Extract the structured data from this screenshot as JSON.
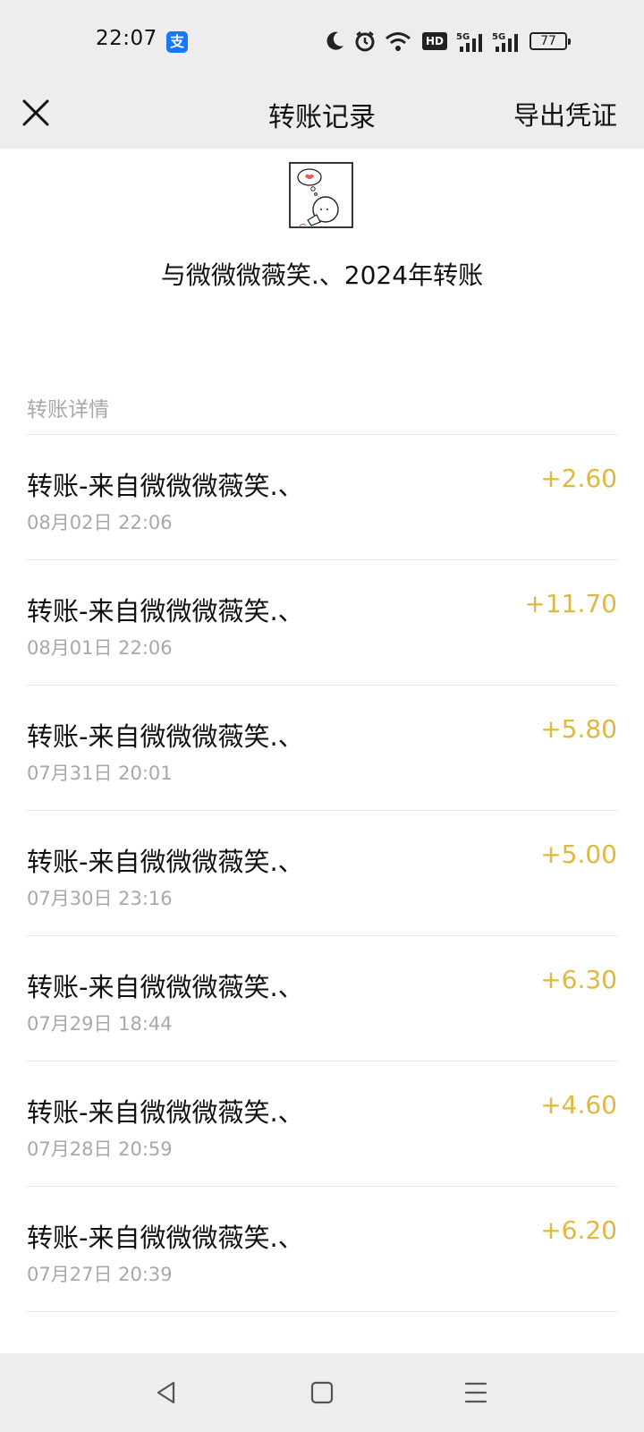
{
  "status_bar": {
    "time": "22:07",
    "app_badge": "支",
    "icons": [
      "moon-icon",
      "alarm-icon",
      "wifi-icon",
      "hd-icon",
      "signal-5g-icon",
      "signal-5g-icon",
      "battery-icon"
    ],
    "hd_label": "HD",
    "battery_level": "77"
  },
  "header": {
    "title": "转账记录",
    "export_label": "导出凭证"
  },
  "partner": {
    "title": "与微微微薇笑.、2024年转账"
  },
  "section_label": "转账详情",
  "colors": {
    "amount": "#e0b840",
    "secondary_text": "#a8a8a8",
    "bar_background": "#ededed"
  },
  "transactions": [
    {
      "title": "转账-来自微微微薇笑.、",
      "date": "08月02日 22:06",
      "amount": "+2.60"
    },
    {
      "title": "转账-来自微微微薇笑.、",
      "date": "08月01日 22:06",
      "amount": "+11.70"
    },
    {
      "title": "转账-来自微微微薇笑.、",
      "date": "07月31日 20:01",
      "amount": "+5.80"
    },
    {
      "title": "转账-来自微微微薇笑.、",
      "date": "07月30日 23:16",
      "amount": "+5.00"
    },
    {
      "title": "转账-来自微微微薇笑.、",
      "date": "07月29日 18:44",
      "amount": "+6.30"
    },
    {
      "title": "转账-来自微微微薇笑.、",
      "date": "07月28日 20:59",
      "amount": "+4.60"
    },
    {
      "title": "转账-来自微微微薇笑.、",
      "date": "07月27日 20:39",
      "amount": "+6.20"
    }
  ],
  "bottom_nav": {
    "icons": [
      "back-triangle-icon",
      "home-square-icon",
      "menu-lines-icon"
    ]
  }
}
